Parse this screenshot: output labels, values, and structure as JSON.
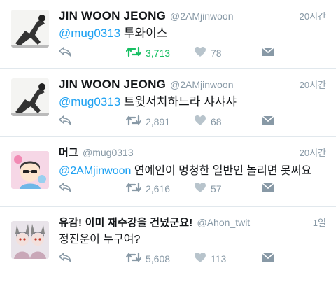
{
  "tweets": [
    {
      "name": "JIN WOON JEONG",
      "handle": "@2AMjinwoon",
      "time": "20시간",
      "mention": "@mug0313",
      "text": " 투와이스",
      "retweets": "3,713",
      "likes": "78",
      "retweet_active": true
    },
    {
      "name": "JIN WOON JEONG",
      "handle": "@2AMjinwoon",
      "time": "20시간",
      "mention": "@mug0313",
      "text": " 트윗서치하느라 샤샤샤",
      "retweets": "2,891",
      "likes": "68",
      "retweet_active": false
    },
    {
      "name": "머그",
      "handle": "@mug0313",
      "time": "20시간",
      "mention": "@2AMjinwoon",
      "text": " 연예인이 멍청한 일반인 놀리면 못써요",
      "retweets": "2,616",
      "likes": "57",
      "retweet_active": false
    },
    {
      "name": "유감! 이미 재수강을 건넜군요!",
      "handle": "@Ahon_twit",
      "time": "1일",
      "mention": "",
      "text": "정진운이 누구여?",
      "retweets": "5,608",
      "likes": "113",
      "retweet_active": false
    }
  ],
  "colors": {
    "accent": "#1da1f2",
    "retweet_active": "#17bf63",
    "muted": "#8899a6",
    "divider": "#e1e8ed"
  },
  "icons": [
    "reply-icon",
    "retweet-icon",
    "like-icon",
    "message-icon"
  ]
}
